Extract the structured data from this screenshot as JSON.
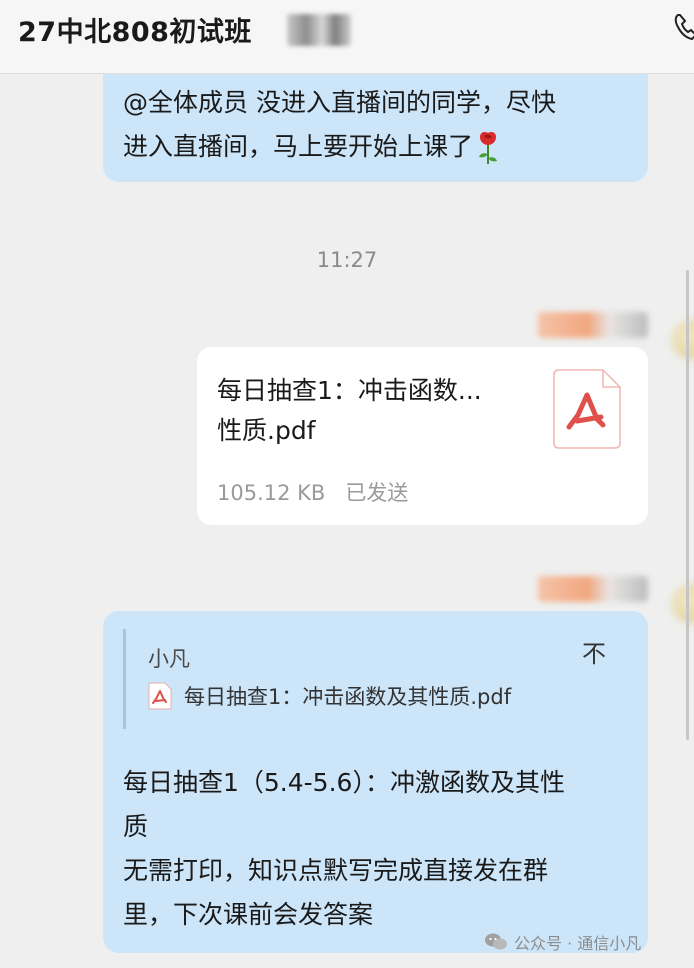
{
  "header": {
    "title": "27中北808初试班"
  },
  "messages": {
    "announcement": {
      "line1": "@全体成员 没进入直播间的同学，尽快",
      "line2": "进入直播间，马上要开始上课了"
    },
    "time": "11:27",
    "file": {
      "name_line1": "每日抽查1：冲击函数...",
      "name_line2": "性质.pdf",
      "size": "105.12 KB",
      "status": "已发送"
    },
    "reply": {
      "quote_sender": "小凡",
      "quote_file": "每日抽查1：冲击函数及其性质.pdf",
      "collapse_symbol": "不",
      "line1": "每日抽查1（5.4-5.6）：冲激函数及其性",
      "line2": "质",
      "line3": "无需打印，知识点默写完成直接发在群",
      "line4": "里，下次课前会发答案"
    }
  },
  "watermark": {
    "text": "公众号 · 通信小凡"
  },
  "colors": {
    "bubble": "#cde5f8",
    "pdf_red": "#e0504a",
    "background": "#efefef"
  }
}
